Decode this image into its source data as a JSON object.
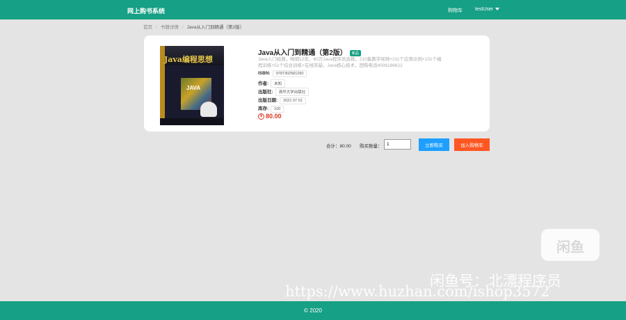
{
  "header": {
    "brand": "网上购书系统",
    "cart": "购物车",
    "user": "testUser"
  },
  "breadcrumb": {
    "home": "首页",
    "detail": "书籍详情",
    "current": "Java从入门到精通（第2版）"
  },
  "book": {
    "cover_title": "Java编程思想",
    "cover_java": "JAVA",
    "title": "Java从入门到精通（第2版）",
    "badge": "新品",
    "description": "Java入门经典，畅销12年，60万Java程序员选择，210集教学视频+211个应用示例+151个编程训练+51个综合训练+在线答疑，Java核心技术，团购电话4006186622",
    "isbn_label": "ISBN:",
    "isbn": "9787302581260",
    "author_label": "作者:",
    "author": "未知",
    "publisher_label": "出版社:",
    "publisher": "清华大学出版社",
    "date_label": "出版日期:",
    "date": "2021 07 01",
    "stock_label": "库存:",
    "stock": "100",
    "price_symbol": "¥",
    "price": "80.00"
  },
  "purchase": {
    "total": "合计：80.00",
    "qty_label": "购买数量：",
    "qty_value": "1",
    "buy_label": "立即购买",
    "cart_label": "加入购物车"
  },
  "watermark": {
    "logo": "闲鱼",
    "name": "闲鱼号：北漂程序员",
    "url": "https://www.huzhan.com/ishop3572"
  },
  "footer": {
    "copyright": "© 2020"
  },
  "colors": {
    "brand_teal": "#16a085",
    "buy_blue": "#1e9fff",
    "cart_orange": "#ff5722",
    "price_red": "#d9341e"
  }
}
